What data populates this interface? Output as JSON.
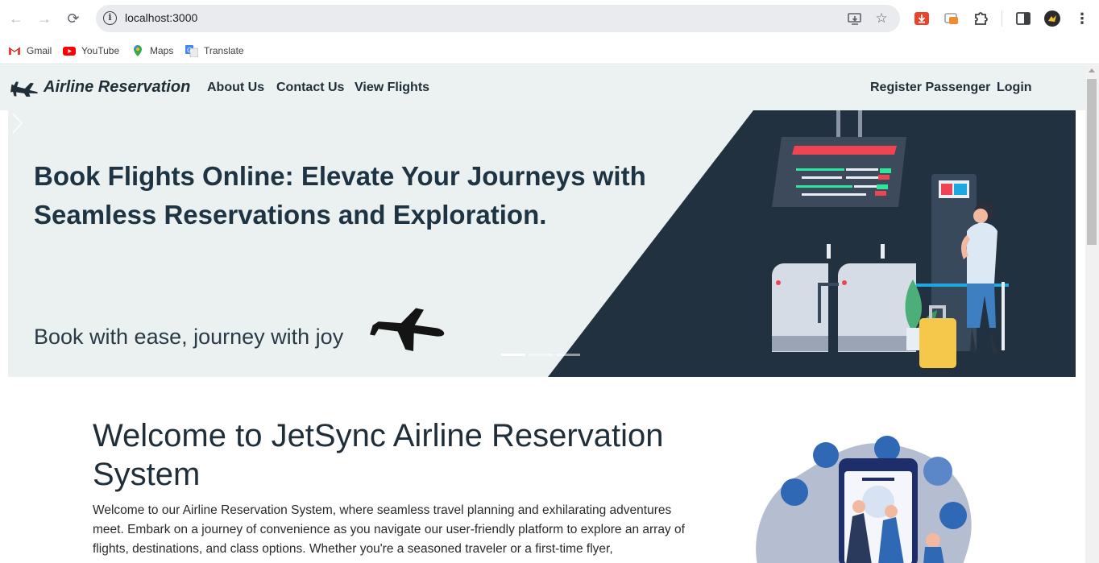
{
  "browser": {
    "url": "localhost:3000",
    "bookmarks": [
      {
        "label": "Gmail",
        "icon": "gmail-icon"
      },
      {
        "label": "YouTube",
        "icon": "youtube-icon"
      },
      {
        "label": "Maps",
        "icon": "maps-icon"
      },
      {
        "label": "Translate",
        "icon": "translate-icon"
      }
    ]
  },
  "navbar": {
    "brand": "Airline Reservation",
    "links": [
      "About Us",
      "Contact Us",
      "View Flights"
    ],
    "right_links": [
      "Register Passenger",
      "Login"
    ]
  },
  "hero": {
    "title": "Book Flights Online: Elevate Your Journeys with Seamless Reservations and Exploration.",
    "subtitle": "Book with ease, journey with joy",
    "slides": 3,
    "active_slide": 1
  },
  "welcome": {
    "title": "Welcome to JetSync Airline Reservation System",
    "text": "Welcome to our Airline Reservation System, where seamless travel planning and exhilarating adventures meet. Embark on a journey of convenience as you navigate our user-friendly platform to explore an array of flights, destinations, and class options. Whether you're a seasoned traveler or a first-time flyer,"
  },
  "colors": {
    "navbar_bg": "#ecf1f1",
    "hero_dark": "#22313f",
    "text_dark": "#1f2e38",
    "flight_board_red": "#ef4452",
    "accent_green": "#2ee59d"
  }
}
